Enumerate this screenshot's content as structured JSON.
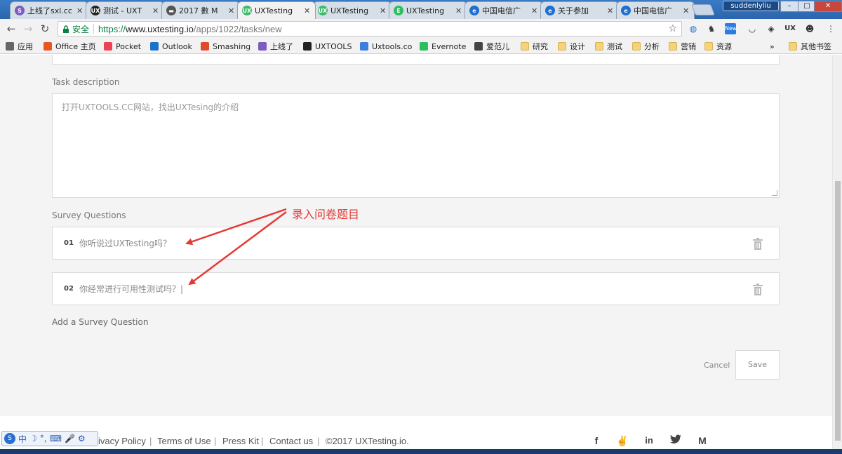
{
  "tabs": [
    {
      "title": "上线了sxl.cc",
      "icon": "sxl-icon",
      "color": "#7c5cbf",
      "glyph": "S"
    },
    {
      "title": "测试 - UXT",
      "icon": "uxtools-icon",
      "color": "#222222",
      "glyph": "UX"
    },
    {
      "title": "2017 數 M",
      "icon": "doc-icon",
      "color": "#555555",
      "glyph": "▬"
    },
    {
      "title": "UXTesting",
      "icon": "uxtesting-icon",
      "color": "#3dbb6b",
      "glyph": "UX",
      "active": true
    },
    {
      "title": "UXTesting",
      "icon": "uxtesting-icon",
      "color": "#3dbb6b",
      "glyph": "UX"
    },
    {
      "title": "UXTesting",
      "icon": "evernote-icon",
      "color": "#2dbe60",
      "glyph": "E"
    },
    {
      "title": "中国电信广",
      "icon": "telecom-icon",
      "color": "#1e6fd0",
      "glyph": "e"
    },
    {
      "title": "关于参加",
      "icon": "telecom-icon",
      "color": "#1e6fd0",
      "glyph": "e"
    },
    {
      "title": "中国电信广",
      "icon": "telecom-icon",
      "color": "#1e6fd0",
      "glyph": "e"
    }
  ],
  "window": {
    "profile": "suddenlyliu"
  },
  "omnibox": {
    "secure_label": "安全",
    "scheme": "https://",
    "host": "www.uxtesting.io",
    "path": "/apps/1022/tasks/new"
  },
  "bookmarks": {
    "items": [
      {
        "label": "应用",
        "icon": "apps-icon",
        "color": "#666666"
      },
      {
        "label": "Office 主页",
        "icon": "office-icon",
        "color": "#e8571f"
      },
      {
        "label": "Pocket",
        "icon": "pocket-icon",
        "color": "#ef4056"
      },
      {
        "label": "Outlook",
        "icon": "outlook-icon",
        "color": "#1a73c8"
      },
      {
        "label": "Smashing",
        "icon": "smashing-icon",
        "color": "#e04b2c"
      },
      {
        "label": "上线了",
        "icon": "sxl-icon",
        "color": "#7c5cbf"
      },
      {
        "label": "UXTOOLS",
        "icon": "uxtools-icon",
        "color": "#222222"
      },
      {
        "label": "Uxtools.co",
        "icon": "uxtools-co-icon",
        "color": "#3b7de0"
      },
      {
        "label": "Evernote",
        "icon": "evernote-icon",
        "color": "#2dbe60"
      },
      {
        "label": "爱范儿",
        "icon": "ifanr-icon",
        "color": "#444444"
      },
      {
        "label": "研究",
        "icon": "folder-icon"
      },
      {
        "label": "设计",
        "icon": "folder-icon"
      },
      {
        "label": "测试",
        "icon": "folder-icon"
      },
      {
        "label": "分析",
        "icon": "folder-icon"
      },
      {
        "label": "营销",
        "icon": "folder-icon"
      },
      {
        "label": "资源",
        "icon": "folder-icon"
      }
    ],
    "overflow": "»",
    "other": "其他书签"
  },
  "form": {
    "description_label": "Task description",
    "description_value": "打开UXTOOLS.CC网站，找出UXTesing的介绍",
    "survey_label": "Survey Questions",
    "questions": [
      {
        "num": "01",
        "text": "你听说过UXTesting吗？"
      },
      {
        "num": "02",
        "text": "你经常进行可用性测试吗？|"
      }
    ],
    "add_question": "Add a Survey Question",
    "cancel": "Cancel",
    "save": "Save"
  },
  "annotation": {
    "text": "录入问卷题目",
    "color": "#e53935"
  },
  "footer": {
    "links": [
      "Privacy Policy",
      "Terms of Use",
      "Press Kit",
      "Contact us"
    ],
    "separator": "|",
    "copyright": "©2017 UXTesting.io."
  },
  "ime": {
    "chars": [
      "中",
      "☽",
      "°,",
      "⌨",
      "🎤",
      "⚙"
    ]
  }
}
